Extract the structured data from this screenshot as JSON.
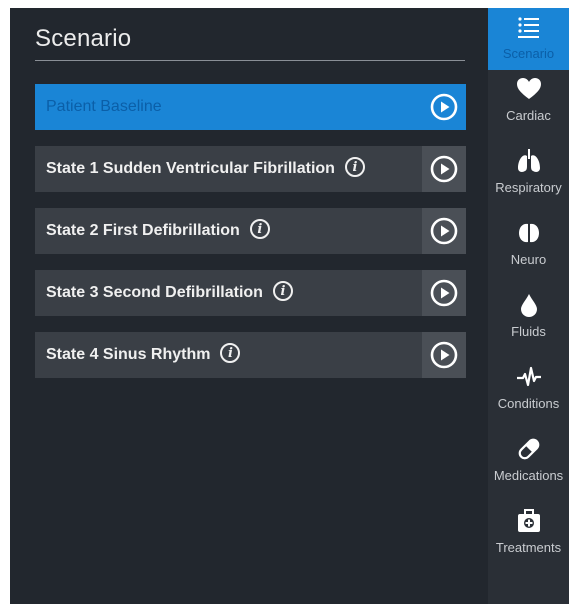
{
  "main": {
    "title": "Scenario",
    "states": [
      {
        "label": "Patient Baseline",
        "active": true,
        "info": false
      },
      {
        "label": "State 1 Sudden Ventricular Fibrillation",
        "active": false,
        "info": true
      },
      {
        "label": "State 2 First Defibrillation",
        "active": false,
        "info": true
      },
      {
        "label": "State 3 Second Defibrillation",
        "active": false,
        "info": true
      },
      {
        "label": "State 4 Sinus Rhythm",
        "active": false,
        "info": true
      }
    ]
  },
  "sidebar": {
    "items": [
      {
        "label": "Scenario",
        "icon": "list-icon",
        "active": true
      },
      {
        "label": "Cardiac",
        "icon": "heart-icon",
        "active": false
      },
      {
        "label": "Respiratory",
        "icon": "lungs-icon",
        "active": false
      },
      {
        "label": "Neuro",
        "icon": "brain-icon",
        "active": false
      },
      {
        "label": "Fluids",
        "icon": "droplet-icon",
        "active": false
      },
      {
        "label": "Conditions",
        "icon": "pulse-icon",
        "active": false
      },
      {
        "label": "Medications",
        "icon": "pill-icon",
        "active": false
      },
      {
        "label": "Treatments",
        "icon": "medkit-icon",
        "active": false
      }
    ]
  },
  "colors": {
    "accent": "#1a85d6",
    "background": "#22272e",
    "row": "#3a3f46",
    "sidebar": "#2a2f36"
  }
}
